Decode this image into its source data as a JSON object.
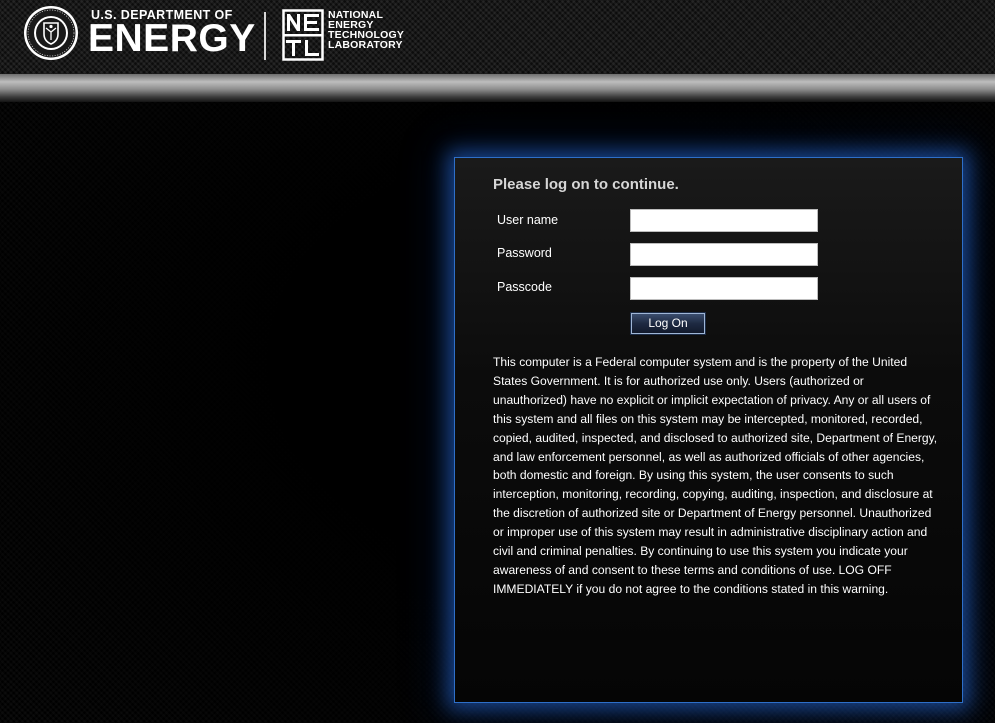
{
  "header": {
    "department_small": "U.S. DEPARTMENT OF",
    "department_big": "ENERGY",
    "lab_name_lines": [
      "NATIONAL",
      "ENERGY",
      "TECHNOLOGY",
      "LABORATORY"
    ],
    "lab_logo_letters": "NETL",
    "seal_icon": "doe-seal-icon",
    "lab_logo_icon": "netl-logo-icon"
  },
  "login": {
    "title": "Please log on to continue.",
    "username_label": "User name",
    "username_value": "",
    "password_label": "Password",
    "password_value": "",
    "passcode_label": "Passcode",
    "passcode_value": "",
    "logon_button": "Log On",
    "warning": "This computer is a Federal computer system and is the property of the United States Government. It is for authorized use only. Users (authorized or unauthorized) have no explicit or implicit expectation of privacy. Any or all users of this system and all files on this system may be intercepted, monitored, recorded, copied, audited, inspected, and disclosed to authorized site, Department of Energy, and law enforcement personnel, as well as authorized officials of other agencies, both domestic and foreign. By using this system, the user consents to such interception, monitoring, recording, copying, auditing, inspection, and disclosure at the discretion of authorized site or Department of Energy personnel. Unauthorized or improper use of this system may result in administrative disciplinary action and civil and criminal penalties. By continuing to use this system you indicate your awareness of and consent to these terms and conditions of use. LOG OFF IMMEDIATELY if you do not agree to the conditions stated in this warning."
  },
  "colors": {
    "page_background": "#000000",
    "panel_border": "#2e6fc8",
    "panel_glow": "#286edc",
    "title_text": "#d6d6d6",
    "button_background": "#1e2a42"
  }
}
